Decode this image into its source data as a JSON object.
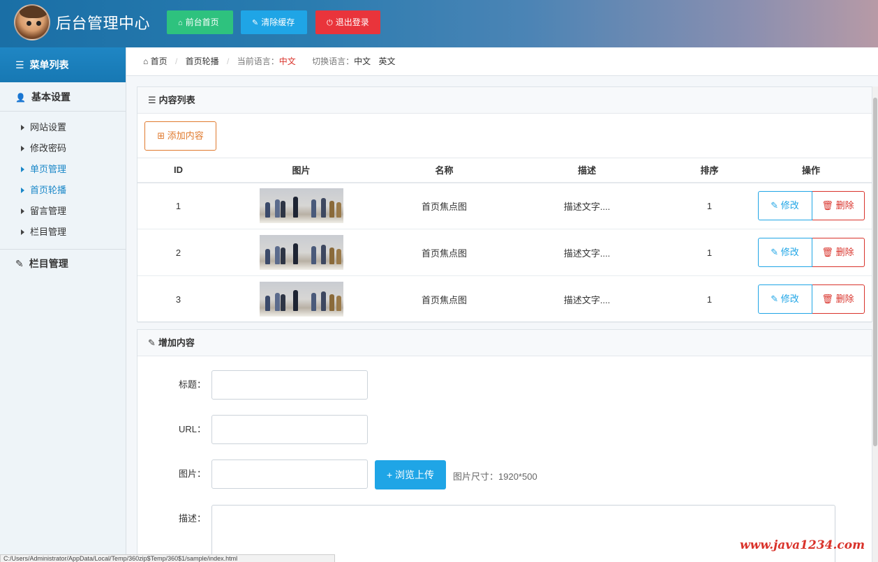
{
  "header": {
    "title": "后台管理中心",
    "buttons": {
      "home": "前台首页",
      "clear_cache": "清除缓存",
      "logout": "退出登录"
    }
  },
  "sidebar": {
    "menu_title": "菜单列表",
    "section_basic": "基本设置",
    "items": [
      {
        "label": "网站设置"
      },
      {
        "label": "修改密码"
      },
      {
        "label": "单页管理"
      },
      {
        "label": "首页轮播"
      },
      {
        "label": "留言管理"
      },
      {
        "label": "栏目管理"
      }
    ],
    "section_column": "栏目管理"
  },
  "breadcrumb": {
    "home": "首页",
    "current": "首页轮播",
    "current_lang_label": "当前语言：",
    "current_lang_value": "中文",
    "switch_lang_label": "切换语言：",
    "lang_zh": "中文",
    "lang_en": "英文"
  },
  "content_list": {
    "title": "内容列表",
    "add_button": "添加内容",
    "columns": [
      "ID",
      "图片",
      "名称",
      "描述",
      "排序",
      "操作"
    ],
    "rows": [
      {
        "id": "1",
        "name": "首页焦点图",
        "desc": "描述文字....",
        "sort": "1"
      },
      {
        "id": "2",
        "name": "首页焦点图",
        "desc": "描述文字....",
        "sort": "1"
      },
      {
        "id": "3",
        "name": "首页焦点图",
        "desc": "描述文字....",
        "sort": "1"
      }
    ],
    "edit_label": "修改",
    "delete_label": "删除"
  },
  "add_form": {
    "title": "增加内容",
    "title_label": "标题：",
    "url_label": "URL：",
    "image_label": "图片：",
    "upload_button": "+ 浏览上传",
    "image_hint": "图片尺寸：1920*500",
    "desc_label": "描述："
  },
  "status_bar": "C:/Users/Administrator/AppData/Local/Temp/360zip$Temp/360$1/sample/index.html",
  "watermark": "www.java1234.com",
  "colors": {
    "accent": "#1fa5e6",
    "success": "#2ec27e",
    "danger": "#e9343b",
    "warning": "#e07a2e"
  }
}
